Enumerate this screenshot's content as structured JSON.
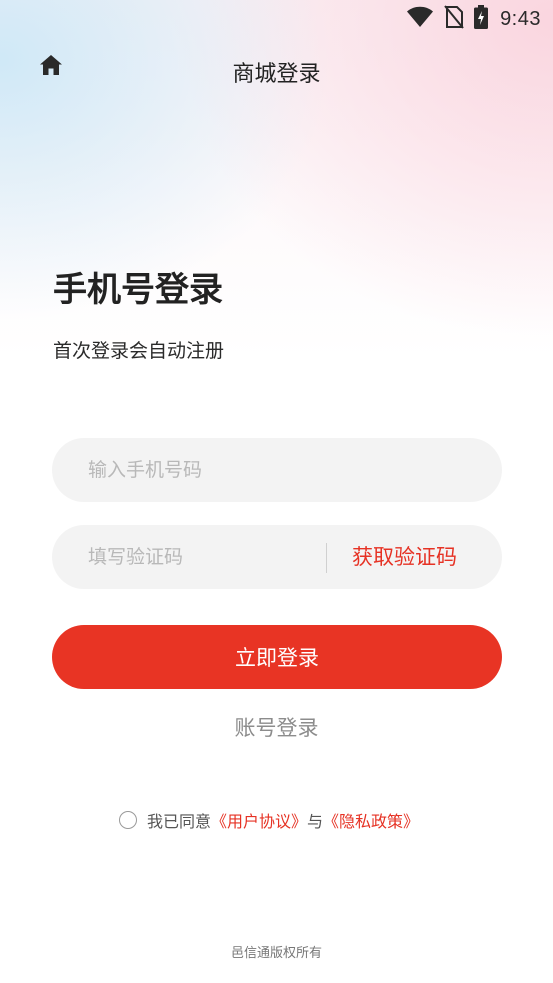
{
  "status_bar": {
    "time": "9:43",
    "icons": [
      "wifi-icon",
      "no-sim-icon",
      "battery-charging-icon"
    ]
  },
  "header": {
    "home_icon": "home-icon",
    "title": "商城登录"
  },
  "login": {
    "title": "手机号登录",
    "subtitle": "首次登录会自动注册",
    "phone_placeholder": "输入手机号码",
    "phone_value": "",
    "code_placeholder": "填写验证码",
    "code_value": "",
    "get_code_label": "获取验证码",
    "submit_label": "立即登录",
    "account_login_label": "账号登录"
  },
  "agreement": {
    "prefix": "我已同意",
    "user_agreement": "《用户协议》",
    "conjunction": "与",
    "privacy_policy": "《隐私政策》",
    "checked": false
  },
  "footer": {
    "copyright": "邑信通版权所有"
  },
  "colors": {
    "accent": "#e83424",
    "link": "#e63224",
    "input_bg": "#f3f3f3"
  }
}
